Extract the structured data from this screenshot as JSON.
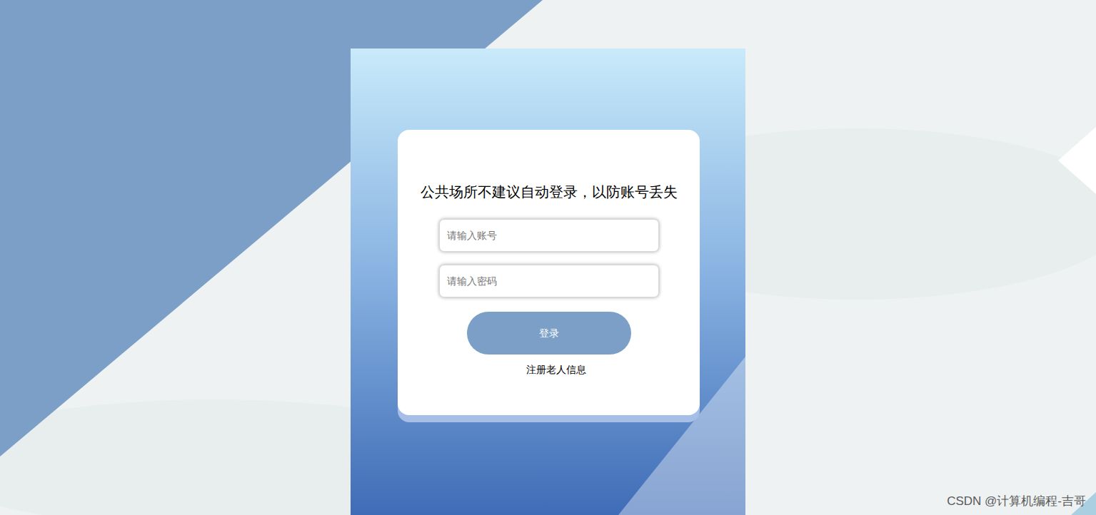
{
  "login": {
    "notice": "公共场所不建议自动登录，以防账号丢失",
    "fields": [
      {
        "placeholder": "请输入账号"
      },
      {
        "placeholder": "请输入密码"
      }
    ],
    "submit": "登录",
    "register_link": "注册老人信息"
  },
  "watermark": "CSDN @计算机编程-吉哥"
}
